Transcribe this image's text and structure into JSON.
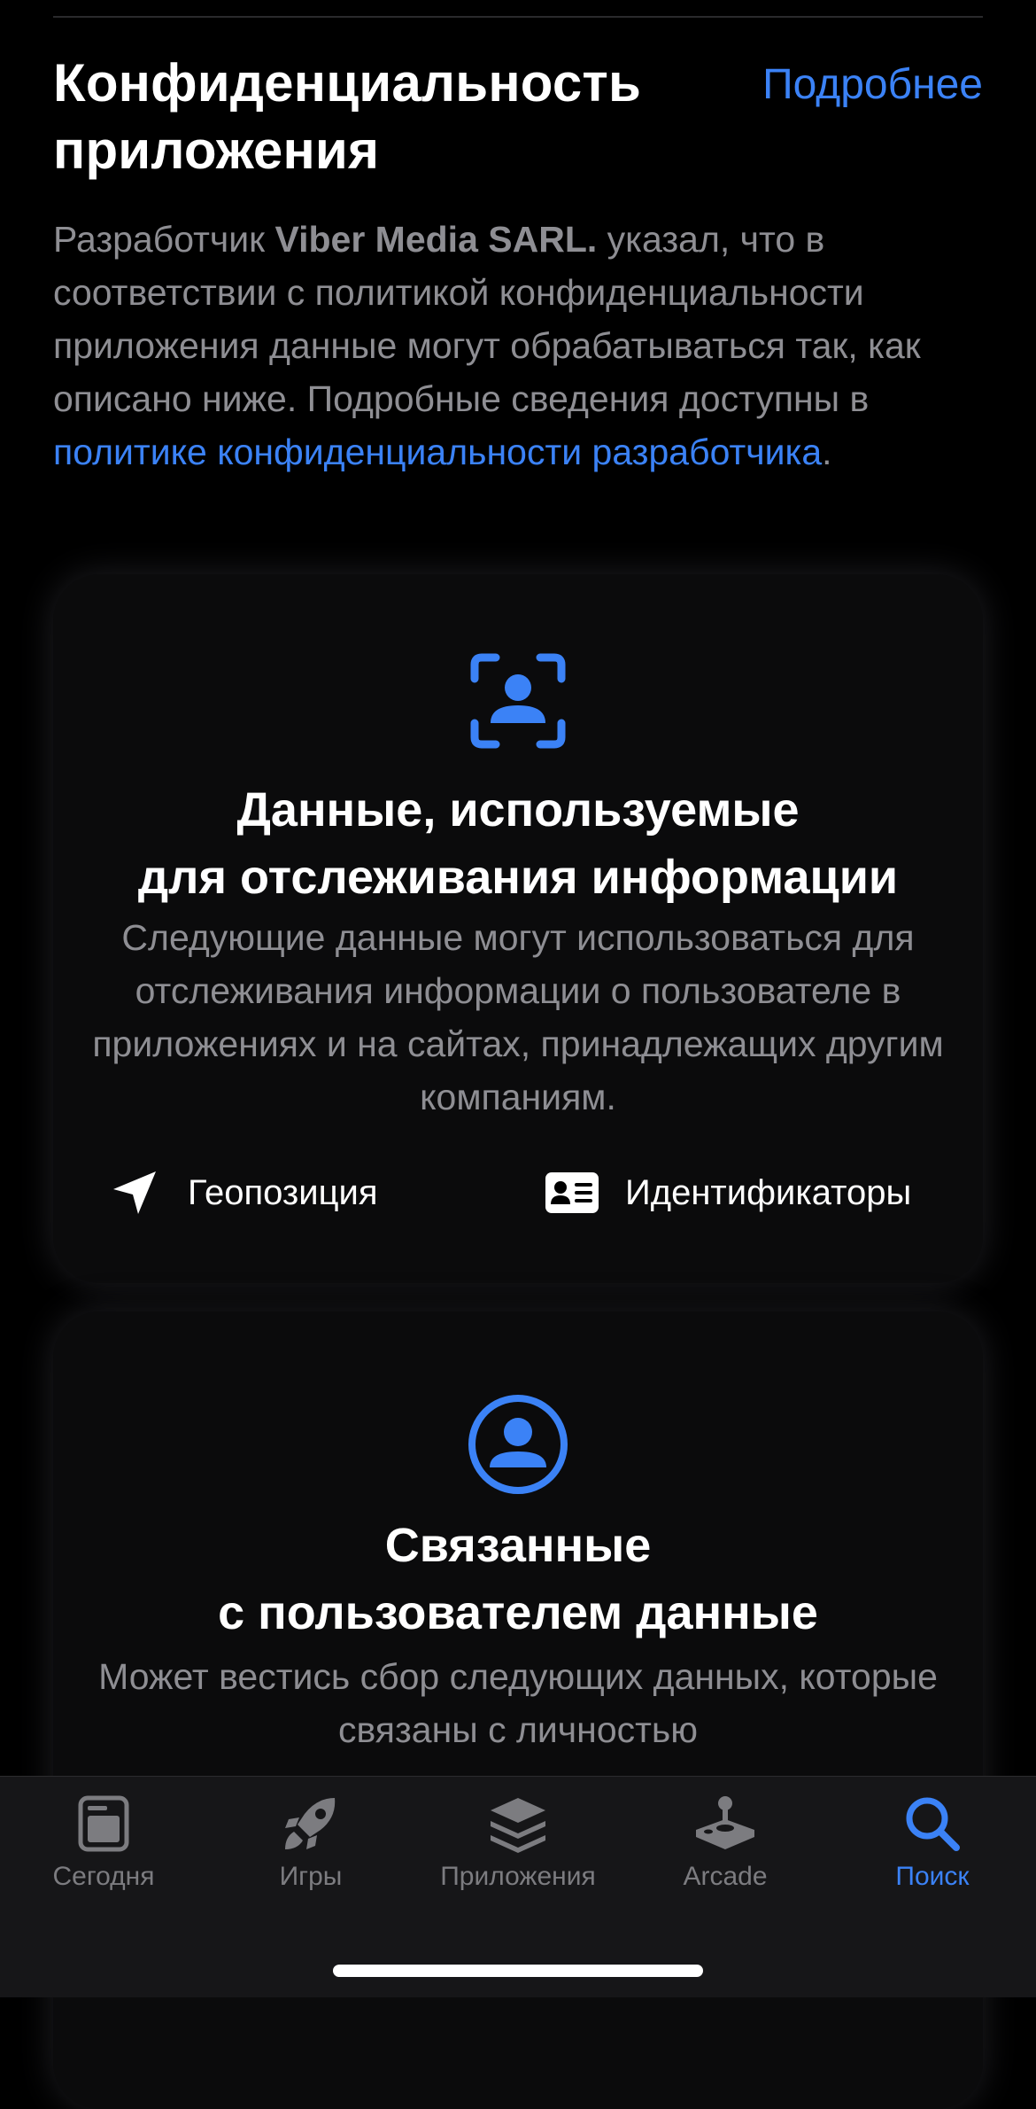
{
  "header": {
    "title": "Конфиденциальность приложения",
    "more_link": "Подробнее"
  },
  "intro": {
    "prefix": "Разработчик ",
    "developer": "Viber Media SARL.",
    "body": " указал, что в соответствии с политикой конфиденциальности приложения данные могут обрабатываться так, как описано ниже. Подробные сведения доступны в ",
    "policy_link": "политике конфиденциальности разработчика",
    "suffix": "."
  },
  "cards": [
    {
      "icon": "tracking-person-icon",
      "title_line1": "Данные, используемые",
      "title_line2": "для отслеживания информации",
      "description": "Следующие данные могут использоваться для отслеживания информации о пользователе в приложениях и на сайтах, принадлежащих другим компаниям.",
      "items": [
        {
          "icon": "location-arrow-icon",
          "label": "Геопозиция"
        },
        {
          "icon": "id-card-icon",
          "label": "Идентификаторы"
        }
      ]
    },
    {
      "icon": "person-circle-icon",
      "title_line1": "Связанные",
      "title_line2": "с пользователем данные",
      "description": "Может вестись сбор следующих данных, которые связаны с личностью"
    }
  ],
  "tab_bar": {
    "active_color": "#3B82F6",
    "inactive_color": "#7C7C80",
    "tabs": [
      {
        "label": "Сегодня",
        "icon": "today-icon",
        "active": false
      },
      {
        "label": "Игры",
        "icon": "rocket-icon",
        "active": false
      },
      {
        "label": "Приложения",
        "icon": "layers-icon",
        "active": false
      },
      {
        "label": "Arcade",
        "icon": "joystick-icon",
        "active": false
      },
      {
        "label": "Поиск",
        "icon": "search-icon",
        "active": true
      }
    ]
  }
}
